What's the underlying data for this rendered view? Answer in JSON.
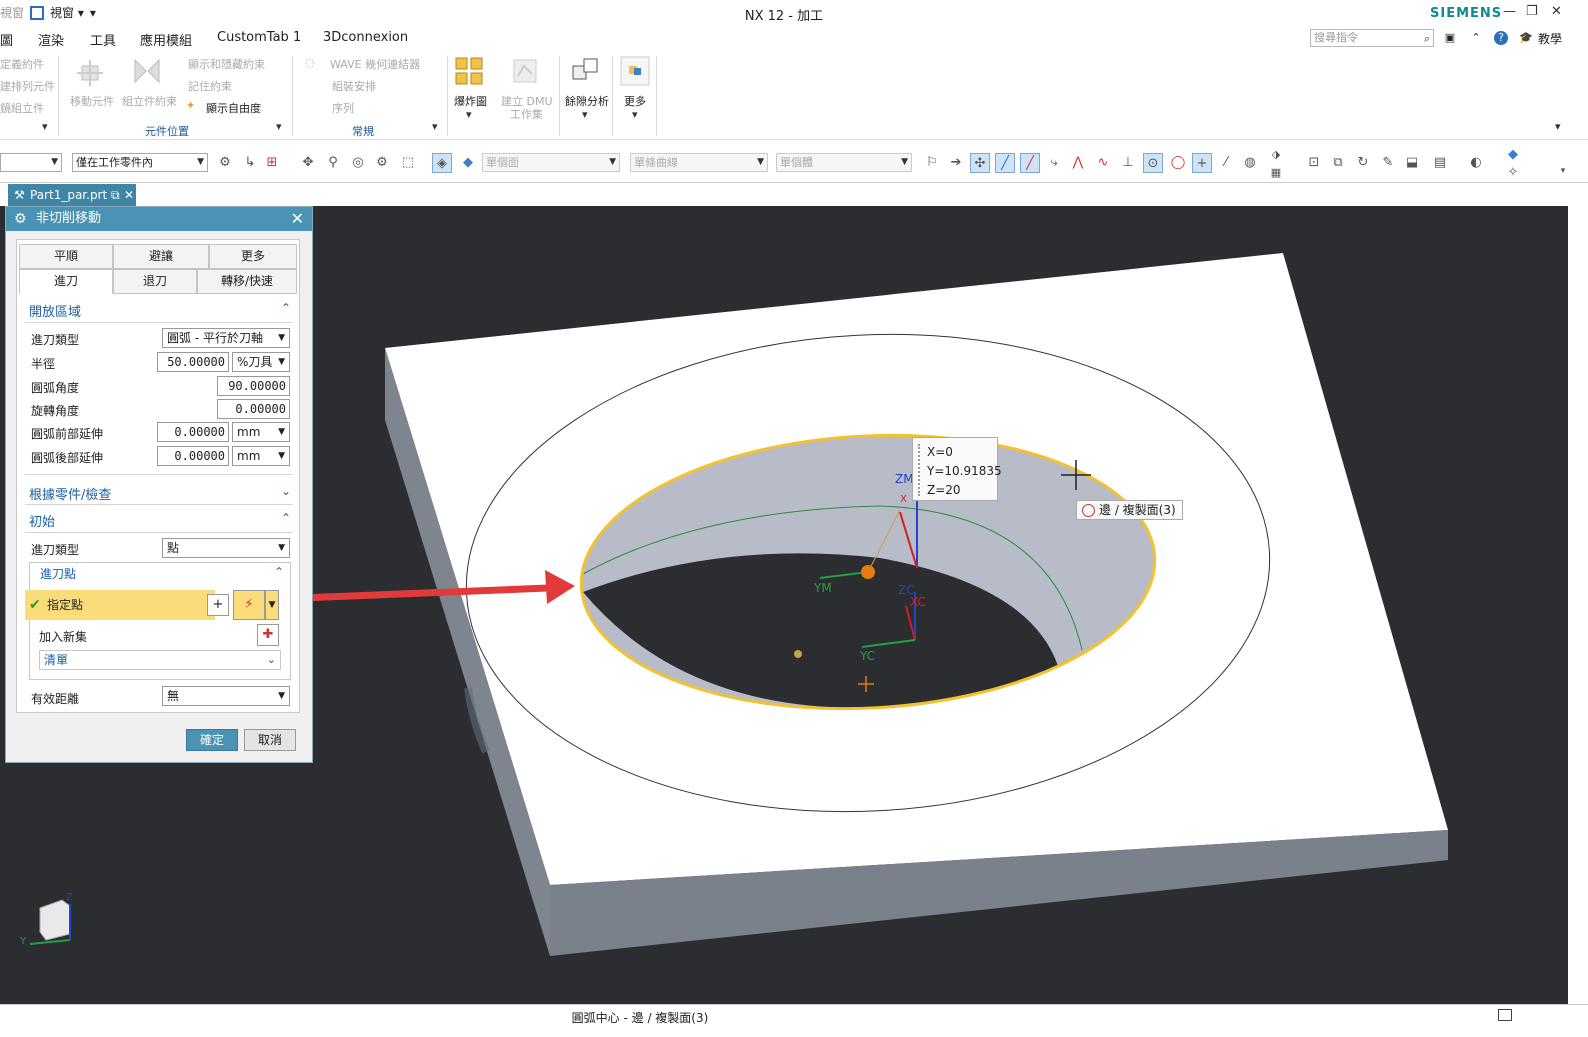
{
  "window": {
    "title": "NX 12 - 加工",
    "brand": "SIEMENS",
    "left_ghost": "視窗",
    "left_menu": "視窗 ▾",
    "help_label": "教學"
  },
  "menubar": {
    "items": [
      "圖",
      "渲染",
      "工具",
      "應用模組",
      "CustomTab 1",
      "3Dconnexion"
    ],
    "search_placeholder": "搜尋指令"
  },
  "ribbon": {
    "assembly_items": [
      "定義約件",
      "建排列元件",
      "鏡組立件"
    ],
    "move_component": "移動元件",
    "assembly_constraints": "組立件約束",
    "show_hide_constraints": "顯示和隱藏約束",
    "remember_constraints": "記住約束",
    "show_dof": "顯示自由度",
    "group_component_position": "元件位置",
    "wave_linker": "WAVE 幾何連結器",
    "arrange": "組裝安排",
    "sequence": "序列",
    "group_general": "常規",
    "exploded_view": "爆炸圖",
    "create_dmu": "建立 DMU",
    "dmu_sub": "工作集",
    "clearance_analysis": "餘隙分析",
    "more": "更多"
  },
  "toolbar": {
    "filter_combo": "僅在工作零件內",
    "face_combo": "單個面",
    "curve_combo": "單條曲線",
    "body_combo": "單個體"
  },
  "document_tab": {
    "name": "Part1_par.prt"
  },
  "dialog": {
    "title": "非切削移動",
    "tabs_row1": [
      "平順",
      "避讓",
      "更多"
    ],
    "tabs_row2": [
      "進刀",
      "退刀",
      "轉移/快速"
    ],
    "section_open_area": "開放區域",
    "engage_type_label": "進刀類型",
    "engage_type_value": "圓弧 - 平行於刀軸",
    "radius_label": "半徑",
    "radius_value": "50.00000",
    "radius_unit": "%刀具",
    "arc_angle_label": "圓弧角度",
    "arc_angle_value": "90.00000",
    "rotate_angle_label": "旋轉角度",
    "rotate_angle_value": "0.00000",
    "arc_front_ext_label": "圓弧前部延伸",
    "arc_front_ext_value": "0.00000",
    "arc_front_ext_unit": "mm",
    "arc_back_ext_label": "圓弧後部延伸",
    "arc_back_ext_value": "0.00000",
    "arc_back_ext_unit": "mm",
    "section_part_check": "根據零件/檢查",
    "section_initial": "初始",
    "initial_engage_type_label": "進刀類型",
    "initial_engage_type_value": "點",
    "sub_engage_point": "進刀點",
    "specify_point": "指定點",
    "add_new_set": "加入新集",
    "list_label": "清單",
    "effective_distance_label": "有效距離",
    "effective_distance_value": "無",
    "ok": "確定",
    "cancel": "取消"
  },
  "viewport": {
    "coord_x": "X=0",
    "coord_y": "Y=10.91835",
    "coord_z": "Z=20",
    "snap_tip": "邊 / 複製面(3)",
    "axis_labels": {
      "zm": "ZM",
      "xm": "X",
      "ym": "YM",
      "zc": "ZC",
      "xc": "XC",
      "yc": "YC"
    },
    "triad_labels": {
      "z": "Z",
      "y": "Y"
    }
  },
  "statusbar": {
    "message": "圓弧中心 - 邊 / 複製面(3)"
  },
  "colors": {
    "dialog_header": "#4a93b4",
    "viewport_bg": "#2b2d31",
    "highlight_edge": "#f2c230",
    "arrow": "#e23a3a",
    "specify_point_bg": "#fbdc7a"
  }
}
